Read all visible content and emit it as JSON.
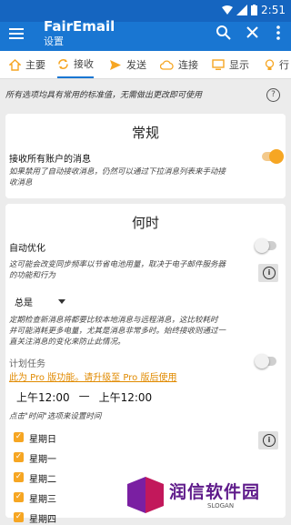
{
  "status": {
    "time": "2:51"
  },
  "appbar": {
    "title": "FairEmail",
    "subtitle": "设置"
  },
  "tabs": [
    {
      "label": "主要",
      "icon": "home-icon"
    },
    {
      "label": "接收",
      "icon": "sync-icon"
    },
    {
      "label": "发送",
      "icon": "send-icon"
    },
    {
      "label": "连接",
      "icon": "cloud-icon"
    },
    {
      "label": "显示",
      "icon": "monitor-icon"
    },
    {
      "label": "行",
      "icon": "bulb-icon"
    }
  ],
  "hint": "所有选项均具有常用的标准值，无需做出更改即可使用",
  "general": {
    "title": "常规",
    "receive_label": "接收所有账户的消息",
    "receive_on": true,
    "receive_desc_1": "如果禁用了自动接收消息，仍然可以通过下拉消息列表来手动接",
    "receive_desc_2": "收消息"
  },
  "timing": {
    "title": "何时",
    "auto_opt_label": "自动优化",
    "auto_opt_on": false,
    "auto_opt_desc_1": "这可能会改变同步频率以节省电池用量，取决于电子邮件服务器",
    "auto_opt_desc_2": "的功能和行为",
    "interval_value": "总是",
    "interval_desc_1": "定期检查新消息将都要比较本地消息与远程消息，这比较耗时",
    "interval_desc_2": "并可能消耗更多电量，尤其是消息非常多时。始终接收则通过一",
    "interval_desc_3": "直关注消息的变化来防止此情况。",
    "schedule_label": "计划任务",
    "schedule_on": false,
    "pro_link": "此为 Pro 版功能。请升级至 Pro 版后使用",
    "time_start": "上午12:00",
    "time_dash": "—",
    "time_end": "上午12:00",
    "time_hint": "点击\"时间\"选项来设置时间",
    "days": [
      "星期日",
      "星期一",
      "星期二",
      "星期三",
      "星期四"
    ]
  },
  "watermark": {
    "brand": "润信软件园",
    "slogan": "SLOGAN"
  }
}
